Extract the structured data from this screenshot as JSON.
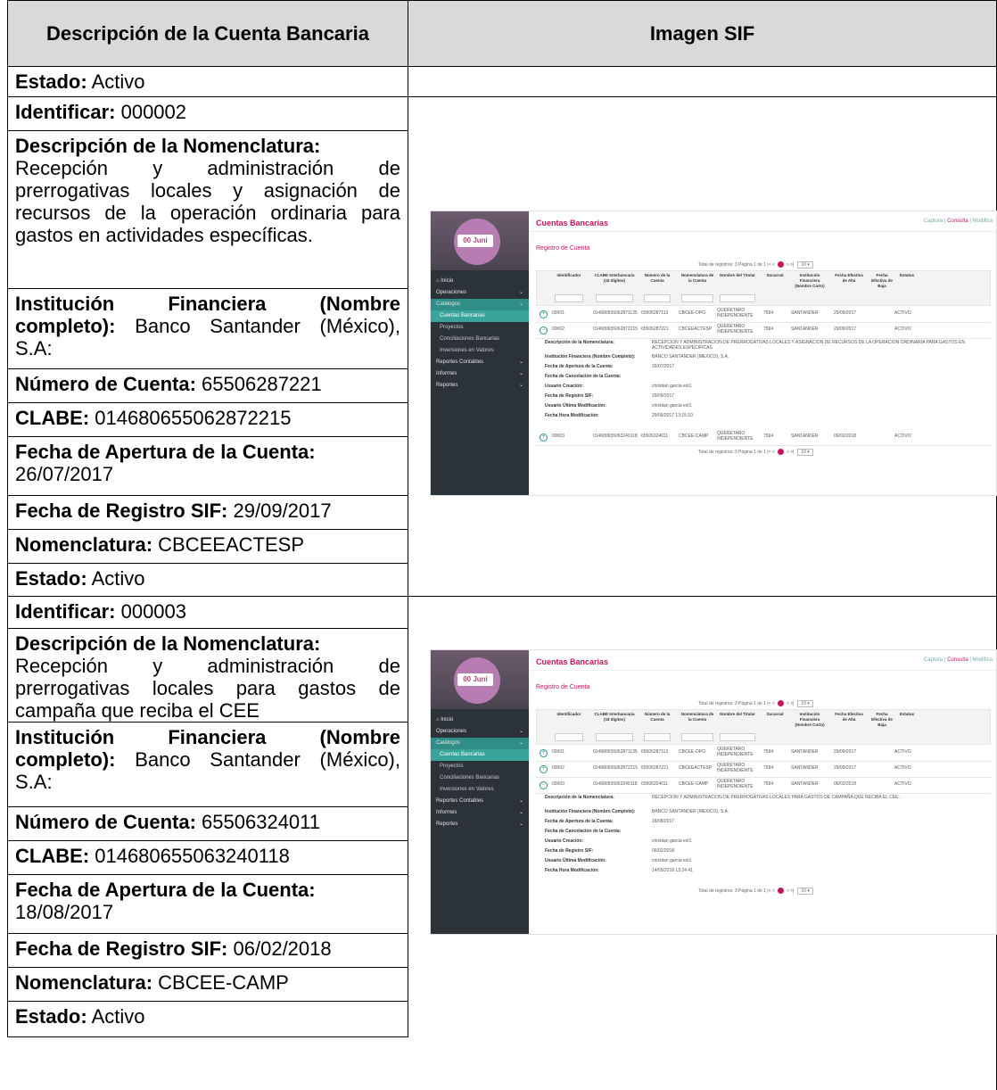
{
  "headers": {
    "left": "Descripción de la Cuenta Bancaria",
    "right": "Imagen SIF"
  },
  "labels": {
    "estado": "Estado:",
    "identificar": "Identificar:",
    "desc_nom": "Descripción de la Nomenclatura:",
    "institucion": "Institución Financiera (Nombre completo):",
    "numero": "Número de Cuenta:",
    "clabe": "CLABE:",
    "apertura": "Fecha de Apertura de la Cuenta:",
    "registro": "Fecha de Registro SIF:",
    "nomenclatura": "Nomenclatura:"
  },
  "top_estado": "Activo",
  "accounts": [
    {
      "identificar": "000002",
      "desc_nom": "Recepción y administración de prerrogativas locales y asignación de recursos de la operación ordinaria para gastos en actividades específicas.",
      "institucion": "Banco Santander (México), S.A:",
      "numero": "65506287221",
      "clabe": "014680655062872215",
      "apertura": "26/07/2017",
      "registro": "29/09/2017",
      "nomenclatura": "CBCEEACTESP",
      "estado": "Activo"
    },
    {
      "identificar": "000003",
      "desc_nom": "Recepción y administración de prerrogativas locales para gastos de campaña que reciba el CEE",
      "institucion": "Banco Santander (México), S.A:",
      "numero": "65506324011",
      "clabe": "014680655063240118",
      "apertura": "18/08/2017",
      "registro": "06/02/2018",
      "nomenclatura": "CBCEE-CAMP",
      "estado": "Activo"
    }
  ],
  "sif": {
    "logo_text": "00 Juni",
    "title": "Cuentas Bancarias",
    "top_links": [
      "Captura",
      "Consulta",
      "Modifica"
    ],
    "subtitle": "Registro de Cuenta",
    "pager": {
      "total": "Total de registros: 3",
      "page": "Página 1 de 1",
      "size": "10"
    },
    "menu": [
      {
        "label": "Inicio",
        "type": "top"
      },
      {
        "label": "Operaciones",
        "type": "top",
        "caret": true
      },
      {
        "label": "Catálogos",
        "type": "active",
        "caret": true
      },
      {
        "label": "Cuentas Bancarias",
        "type": "sub-sel"
      },
      {
        "label": "Proyectos",
        "type": "sub"
      },
      {
        "label": "Conciliaciones Bancarias",
        "type": "sub"
      },
      {
        "label": "Inversiones en Valores",
        "type": "sub"
      },
      {
        "label": "Reportes Contables",
        "type": "top",
        "caret": true
      },
      {
        "label": "Informes",
        "type": "top",
        "caret": true
      },
      {
        "label": "Reportes",
        "type": "top",
        "caret": true
      }
    ],
    "columns": [
      "Identificador",
      "CLABE Interbancaria (18 dígitos)",
      "Número de la Cuenta",
      "Nomenclatura de la Cuenta",
      "Nombre del Titular",
      "Sucursal",
      "Institución Financiera (Nombre Corto)",
      "Fecha Efectiva de Alta",
      "Fecha Efectiva de Baja",
      "Estatus"
    ],
    "rows": [
      [
        "00001",
        "014680655062871135",
        "65506287113",
        "CBCEE-OPO",
        "QUERETARO INDEPENDIENTE",
        "7594",
        "SANTANDER",
        "29/09/2017",
        "",
        "ACTIVO"
      ],
      [
        "00002",
        "014680655062872215",
        "65506287221",
        "CBCEEACTESP",
        "QUERETARO INDEPENDIENTE",
        "7594",
        "SANTANDER",
        "29/09/2017",
        "",
        "ACTIVO"
      ],
      [
        "00003",
        "014680655063240118",
        "65506324011",
        "CBCEE-CAMP",
        "QUERETARO INDEPENDIENTE",
        "7594",
        "SANTANDER",
        "06/02/2018",
        "",
        "ACTIVO"
      ]
    ],
    "detail_keys": [
      "Descripción de la Nomenclatura:",
      "Institución Financiera (Nombre Completo):",
      "Fecha de Apertura de la Cuenta:",
      "Fecha de Cancelación de la Cuenta:",
      "Usuario Creación:",
      "Fecha de Registro SIF:",
      "Usuario Última Modificación:",
      "Fecha Hora Modificación:"
    ],
    "details": [
      [
        "RECEPCION Y ADMINISTRACION DE PRERROGATIVAS LOCALES Y ASIGNACION DE RECURSOS DE LA OPERACION ORDINARIA PARA GASTOS EN ACTIVIDADES ESPECIFICAS",
        "BANCO SANTANDER (MEXICO), S.A.",
        "26/07/2017",
        "",
        "christian garcia ext1",
        "29/09/2017",
        "christian garcia ext1",
        "29/09/2017 13:15:10"
      ],
      [
        "RECEPCION Y ADMINISTRACION DE PRERROGATIVAS LOCALES PARA GASTOS DE CAMPAÑA QUE RECIBA EL CEE.",
        "BANCO SANTANDER (MEXICO), S.A.",
        "18/08/2017",
        "",
        "christian garcia ext1",
        "06/02/2018",
        "christian garcia ext1",
        "14/05/2018 13:24:41"
      ]
    ]
  }
}
